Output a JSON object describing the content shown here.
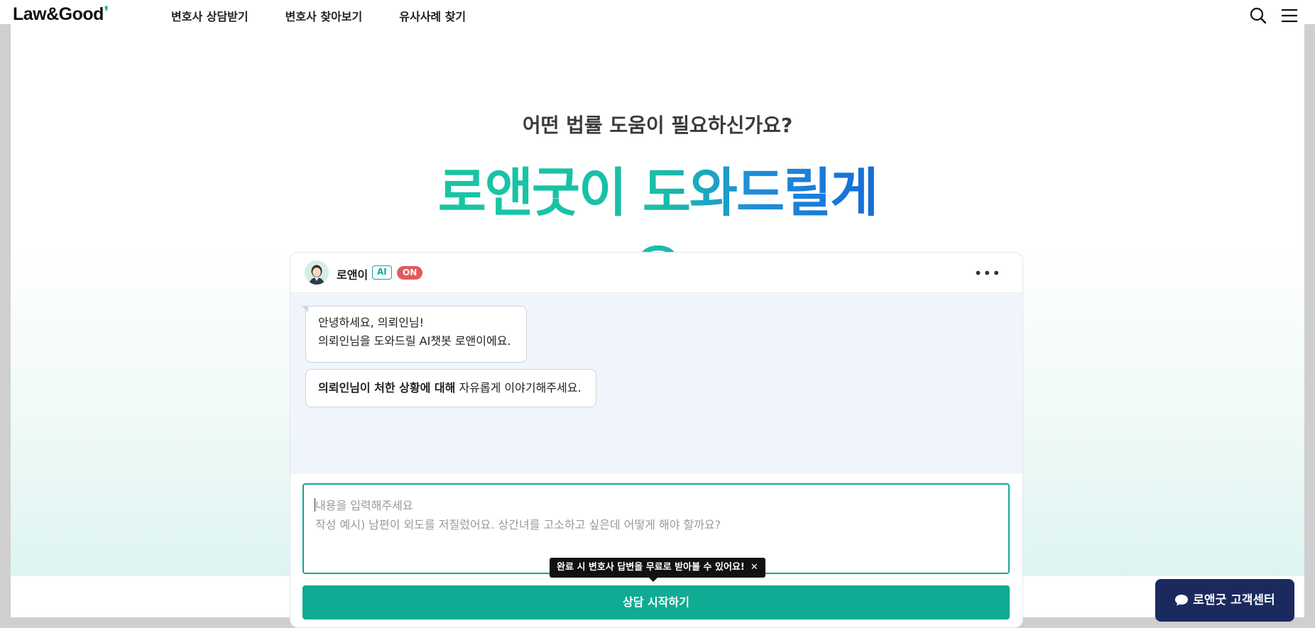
{
  "header": {
    "logo": "Law&Good",
    "nav": [
      "변호사 상담받기",
      "변호사 찾아보기",
      "유사사례 찾기"
    ],
    "icons": [
      "search-icon",
      "menu-icon"
    ]
  },
  "hero": {
    "subtitle": "어떤 법률 도움이 필요하신가요?",
    "title": "로앤굿이 도와드릴게요"
  },
  "chat": {
    "bot_name": "로앤이",
    "ai_badge": "AI",
    "status_badge": "ON",
    "more_label": "•••",
    "message1_line1": "안녕하세요, 의뢰인님!",
    "message1_line2": "의뢰인님을 도와드릴 AI챗봇 로앤이에요.",
    "message2_bold": "의뢰인님이 처한 상황에 대해",
    "message2_rest": " 자유롭게 이야기해주세요.",
    "input_placeholder_line1": "내용을 입력해주세요",
    "input_placeholder_line2": "작성 예시) 남편이 외도를 저질렀어요. 상간녀를 고소하고 싶은데 어떻게 해야 할까요?",
    "tooltip": "완료 시 변호사 답변을 무료로 받아볼 수 있어요!",
    "tooltip_close": "✕",
    "start_button": "상담 시작하기"
  },
  "customer_center": {
    "label": "로앤굿 고객센터"
  },
  "colors": {
    "accent": "#0fab92",
    "navy": "#1b2a5e",
    "on_badge": "#e25b5b"
  }
}
